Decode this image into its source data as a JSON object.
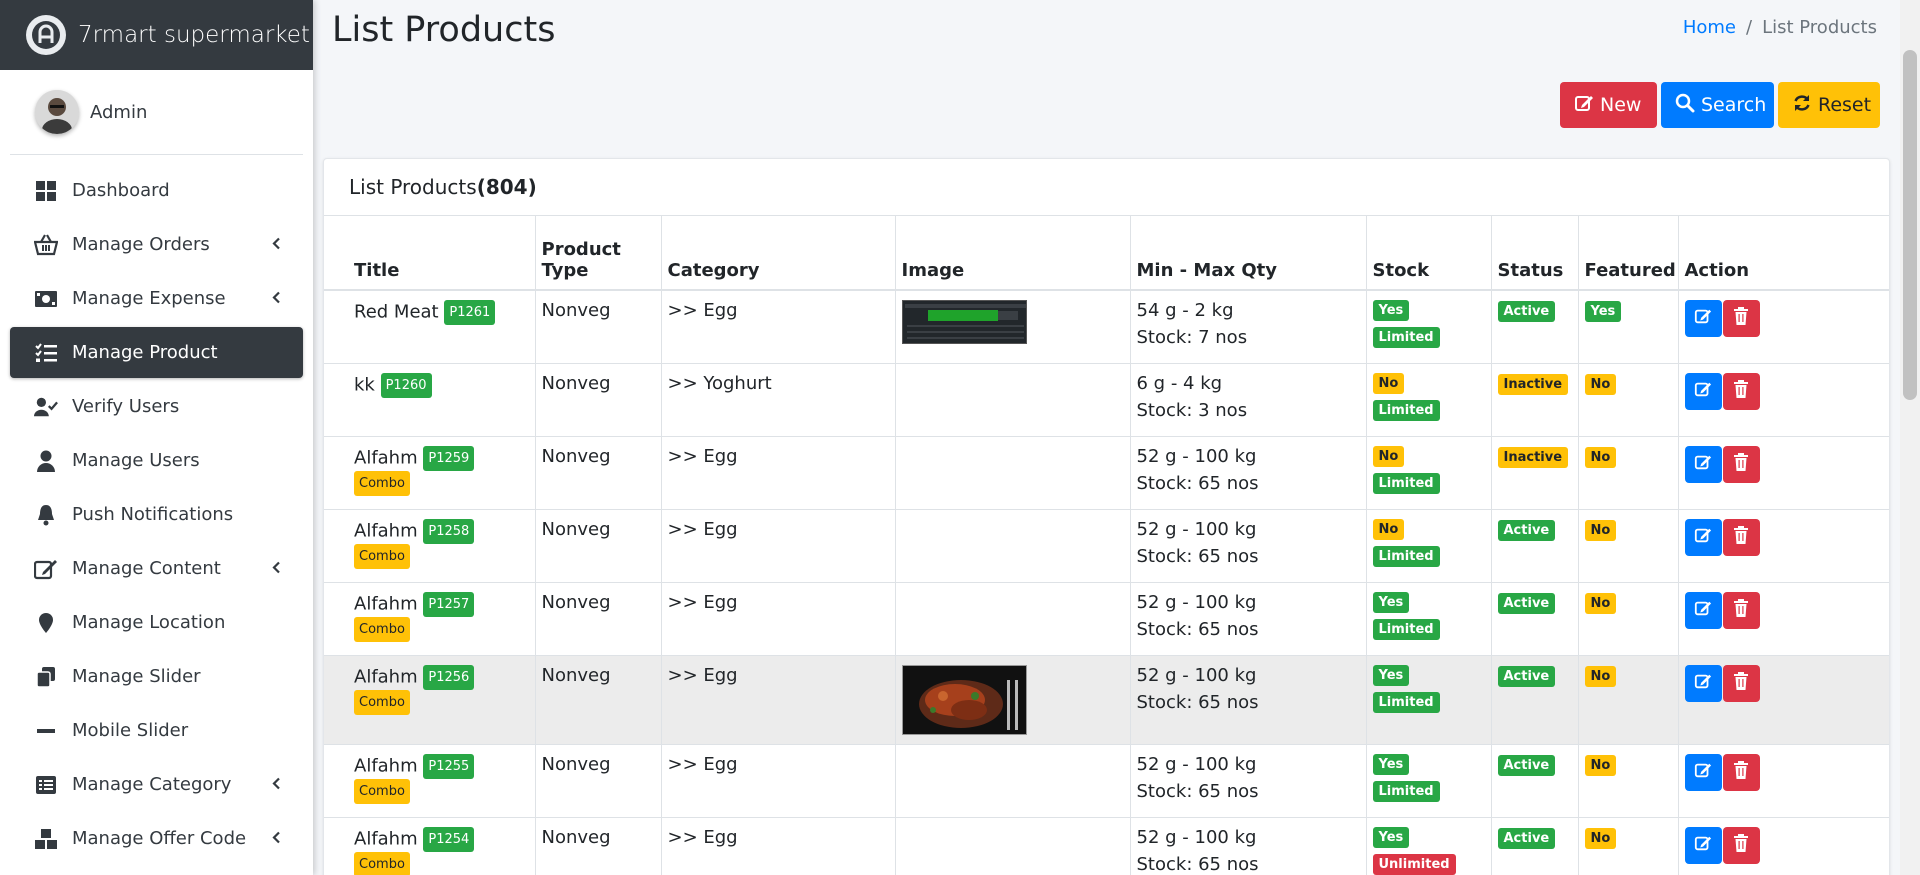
{
  "brand": {
    "name": "7rmart supermarket"
  },
  "user": {
    "name": "Admin"
  },
  "sidebar": {
    "items": [
      {
        "label": "Dashboard",
        "icon": "dashboard-icon",
        "chevron": false,
        "active": false
      },
      {
        "label": "Manage Orders",
        "icon": "basket-icon",
        "chevron": true,
        "active": false
      },
      {
        "label": "Manage Expense",
        "icon": "money-icon",
        "chevron": true,
        "active": false
      },
      {
        "label": "Manage Product",
        "icon": "list-check-icon",
        "chevron": false,
        "active": true
      },
      {
        "label": "Verify Users",
        "icon": "user-check-icon",
        "chevron": false,
        "active": false
      },
      {
        "label": "Manage Users",
        "icon": "user-icon",
        "chevron": false,
        "active": false
      },
      {
        "label": "Push Notifications",
        "icon": "bell-icon",
        "chevron": false,
        "active": false
      },
      {
        "label": "Manage Content",
        "icon": "edit-icon",
        "chevron": true,
        "active": false
      },
      {
        "label": "Manage Location",
        "icon": "map-marker-icon",
        "chevron": false,
        "active": false
      },
      {
        "label": "Manage Slider",
        "icon": "clone-icon",
        "chevron": false,
        "active": false
      },
      {
        "label": "Mobile Slider",
        "icon": "minus-icon",
        "chevron": false,
        "active": false
      },
      {
        "label": "Manage Category",
        "icon": "list-alt-icon",
        "chevron": true,
        "active": false
      },
      {
        "label": "Manage Offer Code",
        "icon": "cubes-icon",
        "chevron": true,
        "active": false
      }
    ]
  },
  "page": {
    "title": "List Products"
  },
  "breadcrumb": {
    "home": "Home",
    "separator": "/",
    "current": "List Products"
  },
  "toolbar": {
    "new_label": "New",
    "search_label": "Search",
    "reset_label": "Reset"
  },
  "card": {
    "title": "List Products",
    "count": "(804)"
  },
  "table": {
    "headers": {
      "title": "Title",
      "product_type": "Product Type",
      "category": "Category",
      "image": "Image",
      "min_max_qty": "Min - Max Qty",
      "stock": "Stock",
      "status": "Status",
      "featured": "Featured",
      "action": "Action"
    },
    "rows": [
      {
        "title": "Red Meat",
        "code": "P1261",
        "combo": "",
        "type": "Nonveg",
        "category": ">> Egg",
        "image": "screen",
        "qty": "54 g - 2 kg",
        "stock_qty": "Stock: 7 nos",
        "stock": "Yes",
        "limit": "Limited",
        "status": "Active",
        "featured": "Yes"
      },
      {
        "title": "kk",
        "code": "P1260",
        "combo": "",
        "type": "Nonveg",
        "category": ">> Yoghurt",
        "image": "",
        "qty": "6 g - 4 kg",
        "stock_qty": "Stock: 3 nos",
        "stock": "No",
        "limit": "Limited",
        "status": "Inactive",
        "featured": "No"
      },
      {
        "title": "Alfahm",
        "code": "P1259",
        "combo": "Combo",
        "type": "Nonveg",
        "category": ">> Egg",
        "image": "",
        "qty": "52 g - 100 kg",
        "stock_qty": "Stock: 65 nos",
        "stock": "No",
        "limit": "Limited",
        "status": "Inactive",
        "featured": "No"
      },
      {
        "title": "Alfahm",
        "code": "P1258",
        "combo": "Combo",
        "type": "Nonveg",
        "category": ">> Egg",
        "image": "",
        "qty": "52 g - 100 kg",
        "stock_qty": "Stock: 65 nos",
        "stock": "No",
        "limit": "Limited",
        "status": "Active",
        "featured": "No"
      },
      {
        "title": "Alfahm",
        "code": "P1257",
        "combo": "Combo",
        "type": "Nonveg",
        "category": ">> Egg",
        "image": "",
        "qty": "52 g - 100 kg",
        "stock_qty": "Stock: 65 nos",
        "stock": "Yes",
        "limit": "Limited",
        "status": "Active",
        "featured": "No"
      },
      {
        "title": "Alfahm",
        "code": "P1256",
        "combo": "Combo",
        "type": "Nonveg",
        "category": ">> Egg",
        "image": "food",
        "qty": "52 g - 100 kg",
        "stock_qty": "Stock: 65 nos",
        "stock": "Yes",
        "limit": "Limited",
        "status": "Active",
        "featured": "No"
      },
      {
        "title": "Alfahm",
        "code": "P1255",
        "combo": "Combo",
        "type": "Nonveg",
        "category": ">> Egg",
        "image": "",
        "qty": "52 g - 100 kg",
        "stock_qty": "Stock: 65 nos",
        "stock": "Yes",
        "limit": "Limited",
        "status": "Active",
        "featured": "No"
      },
      {
        "title": "Alfahm",
        "code": "P1254",
        "combo": "Combo",
        "type": "Nonveg",
        "category": ">> Egg",
        "image": "",
        "qty": "52 g - 100 kg",
        "stock_qty": "Stock: 65 nos",
        "stock": "Yes",
        "limit": "Unlimited",
        "status": "Active",
        "featured": "No"
      }
    ]
  },
  "colors": {
    "primary": "#007bff",
    "danger": "#dc3545",
    "warning": "#ffc107",
    "success": "#28a745",
    "dark": "#343a40"
  }
}
